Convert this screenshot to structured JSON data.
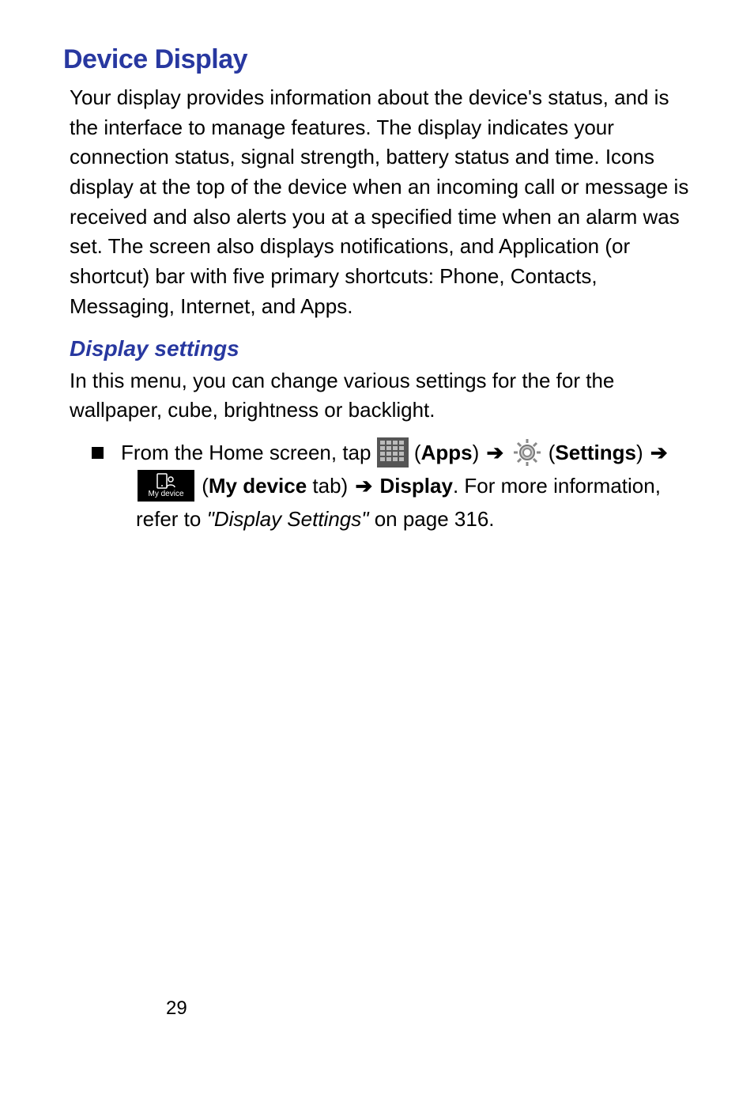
{
  "title": "Device Display",
  "intro": "Your display provides information about the device's status, and is the interface to manage features. The display indicates your connection status, signal strength, battery status and time. Icons display at the top of the device when an incoming call or message is received and also alerts you at a specified time when an alarm was set. The screen also displays notifications, and Application (or shortcut) bar with five primary shortcuts: Phone, Contacts, Messaging, Internet, and Apps.",
  "subheading": "Display settings",
  "sub_intro": "In this menu, you can change various settings for the for the wallpaper, cube, brightness or backlight.",
  "step": {
    "lead": "From the Home screen, tap ",
    "apps_label": "Apps",
    "settings_label": "Settings",
    "mydevice_label": "My device",
    "mydevice_icon_text": "My device",
    "tab_suffix": " tab) ",
    "display_label": "Display",
    "trailing": ". For more information, refer to ",
    "ref_title": "\"Display Settings\"",
    "ref_page": " on page 316."
  },
  "page_number": "29"
}
